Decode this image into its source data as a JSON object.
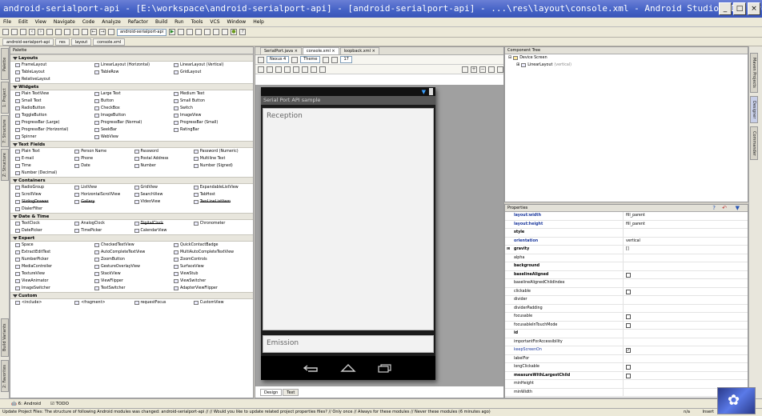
{
  "window": {
    "title": "android-serialport-api - [E:\\workspace\\android-serialport-api] - [android-serialport-api] - ...\\res\\layout\\console.xml - Android Studio (I/O Pre..."
  },
  "menu": [
    "File",
    "Edit",
    "View",
    "Navigate",
    "Code",
    "Analyze",
    "Refactor",
    "Build",
    "Run",
    "Tools",
    "VCS",
    "Window",
    "Help"
  ],
  "toolbar": {
    "module": "android-serialport-api",
    "help": "?"
  },
  "breadcrumbs": [
    "android-serialport-api",
    "res",
    "layout",
    "console.xml"
  ],
  "left_tabs": [
    "Palette",
    "1: Project",
    "7: Structure",
    "Z: Structure",
    "Build Variants",
    "2: Favorites"
  ],
  "palette": {
    "header": "Palette",
    "sections": [
      {
        "title": "Layouts",
        "cols": 3,
        "items": [
          "FrameLayout",
          "LinearLayout (Horizontal)",
          "LinearLayout (Vertical)",
          "TableLayout",
          "TableRow",
          "GridLayout",
          "RelativeLayout"
        ]
      },
      {
        "title": "Widgets",
        "cols": 3,
        "items": [
          "Plain TextView",
          "Large Text",
          "Medium Text",
          "Small Text",
          "Button",
          "Small Button",
          "RadioButton",
          "CheckBox",
          "Switch",
          "ToggleButton",
          "ImageButton",
          "ImageView",
          "ProgressBar (Large)",
          "ProgressBar (Normal)",
          "ProgressBar (Small)",
          "ProgressBar (Horizontal)",
          "SeekBar",
          "RatingBar",
          "Spinner",
          "WebView"
        ]
      },
      {
        "title": "Text Fields",
        "cols": 4,
        "items": [
          "Plain Text",
          "Person Name",
          "Password",
          "Password (Numeric)",
          "E-mail",
          "Phone",
          "Postal Address",
          "Multiline Text",
          "Time",
          "Date",
          "Number",
          "Number (Signed)",
          "Number (Decimal)"
        ]
      },
      {
        "title": "Containers",
        "cols": 4,
        "items": [
          "RadioGroup",
          "ListView",
          "GridView",
          "ExpandableListView",
          "ScrollView",
          "HorizontalScrollView",
          "SearchView",
          "TabHost",
          "SlidingDrawer",
          "Gallery",
          "VideoView",
          "TwoLineListItem",
          "DialerFilter"
        ],
        "strike": [
          "SlidingDrawer",
          "Gallery",
          "TwoLineListItem"
        ]
      },
      {
        "title": "Date & Time",
        "cols": 4,
        "items": [
          "TextClock",
          "AnalogClock",
          "DigitalClock",
          "Chronometer",
          "DatePicker",
          "TimePicker",
          "CalendarView"
        ],
        "strike": [
          "DigitalClock"
        ]
      },
      {
        "title": "Expert",
        "cols": 3,
        "items": [
          "Space",
          "CheckedTextView",
          "QuickContactBadge",
          "ExtractEditText",
          "AutoCompleteTextView",
          "MultiAutoCompleteTextView",
          "NumberPicker",
          "ZoomButton",
          "ZoomControls",
          "MediaController",
          "GestureOverlayView",
          "SurfaceView",
          "TextureView",
          "StackView",
          "ViewStub",
          "ViewAnimator",
          "ViewFlipper",
          "ViewSwitcher",
          "ImageSwitcher",
          "TextSwitcher",
          "AdapterViewFlipper"
        ]
      },
      {
        "title": "Custom",
        "cols": 4,
        "items": [
          "<include>",
          "<fragment>",
          "requestFocus",
          "CustomView"
        ]
      }
    ]
  },
  "editor": {
    "tabs": [
      "SerialPort.java",
      "console.xml",
      "loopback.xml"
    ],
    "active_tab": "console.xml",
    "device": "Nexus 4",
    "theme": "Theme",
    "api": "17",
    "app_title": "Serial Port API sample",
    "reception": "Reception",
    "emission": "Emission",
    "bottom_tabs": [
      "Design",
      "Text"
    ]
  },
  "component_tree": {
    "header": "Component Tree",
    "root": "Device Screen",
    "child": "LinearLayout",
    "child_note": "(vertical)"
  },
  "properties": {
    "header": "Properties",
    "rows": [
      {
        "k": "layout:width",
        "v": "fill_parent",
        "style": "bold-blue"
      },
      {
        "k": "layout:height",
        "v": "fill_parent",
        "style": "bold-blue"
      },
      {
        "k": "style",
        "v": "",
        "style": "bold"
      },
      {
        "k": "orientation",
        "v": "vertical",
        "style": "bold-blue"
      },
      {
        "k": "gravity",
        "v": "[]",
        "style": "bold",
        "expand": true
      },
      {
        "k": "alpha",
        "v": ""
      },
      {
        "k": "background",
        "v": "",
        "style": "bold"
      },
      {
        "k": "baselineAligned",
        "v": "cb",
        "style": "bold"
      },
      {
        "k": "baselineAlignedChildIndex",
        "v": ""
      },
      {
        "k": "clickable",
        "v": "cb"
      },
      {
        "k": "divider",
        "v": ""
      },
      {
        "k": "dividerPadding",
        "v": ""
      },
      {
        "k": "focusable",
        "v": "cb"
      },
      {
        "k": "focusableInTouchMode",
        "v": "cb"
      },
      {
        "k": "id",
        "v": "",
        "style": "bold"
      },
      {
        "k": "importantForAccessibility",
        "v": ""
      },
      {
        "k": "keepScreenOn",
        "v": "cbx",
        "style": "blue"
      },
      {
        "k": "labelFor",
        "v": ""
      },
      {
        "k": "longClickable",
        "v": "cb"
      },
      {
        "k": "measureWithLargestChild",
        "v": "cb",
        "style": "bold"
      },
      {
        "k": "minHeight",
        "v": ""
      },
      {
        "k": "minWidth",
        "v": ""
      }
    ]
  },
  "right_tabs": [
    "Maven Projects",
    "Designer",
    "Commander"
  ],
  "bottom": {
    "android": "6: Android",
    "todo": "TODO"
  },
  "status": {
    "message": "Update Project Files: The structure of following Android modules was changed: android-serialport-api // // Would you like to update related project properties files? // Only once // Always for these modules // Never these modules (6 minutes ago)",
    "position": "n/a",
    "mode": "Insert"
  },
  "colors": {
    "accent": "#4361c5",
    "action_bar": "#575757"
  }
}
